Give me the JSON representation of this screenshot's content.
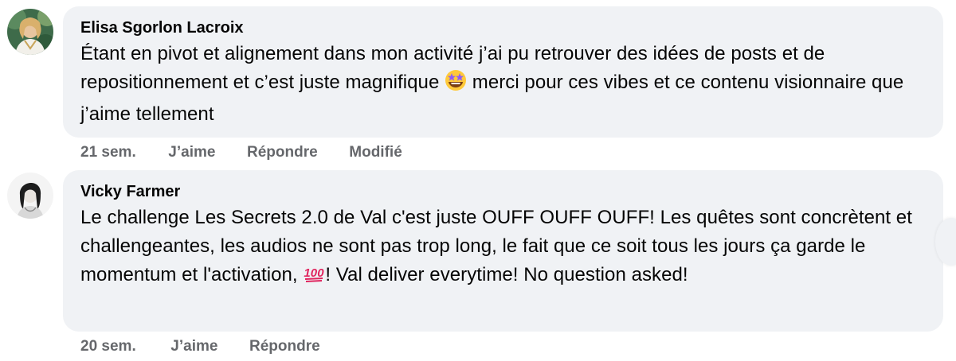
{
  "comments": [
    {
      "author": "Elisa Sgorlon Lacroix",
      "text_before_emoji": "Étant en pivot et alignement dans mon activité j’ai pu retrouver des idées de posts et de repositionnement et c’est juste magnifique ",
      "emoji": "star-struck-emoji",
      "text_after_emoji": " merci pour ces vibes et ce contenu visionnaire que j’aime tellement",
      "time": "21 sem.",
      "like_label": "J’aime",
      "reply_label": "Répondre",
      "edited_label": "Modifié"
    },
    {
      "author": "Vicky Farmer",
      "text_before_emoji": "Le challenge Les Secrets 2.0 de Val c'est juste OUFF OUFF OUFF! Les quêtes sont concrètent et challengeantes, les audios ne sont pas trop long, le fait que ce soit tous les jours ça garde le momentum et l'activation, ",
      "emoji": "hundred-points-emoji",
      "emoji_text": "100",
      "text_after_emoji": "! Val deliver everytime! No question asked!",
      "time": "20 sem.",
      "like_label": "J’aime",
      "reply_label": "Répondre"
    }
  ],
  "colors": {
    "bubble_bg": "#f0f2f5",
    "text": "#050505",
    "secondary_text": "#65676b",
    "hundred_red": "#e0245e"
  }
}
